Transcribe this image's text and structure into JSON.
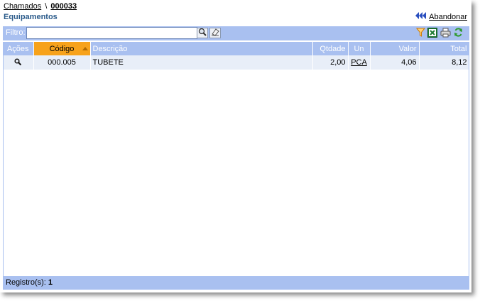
{
  "breadcrumb": {
    "parent": "Chamados",
    "separator": "\\",
    "current": "000033"
  },
  "section_title": "Equipamentos",
  "abandon_label": "Abandonar",
  "filter": {
    "label": "Filtro:",
    "value": ""
  },
  "table": {
    "columns": [
      "Ações",
      "Código",
      "Descrição",
      "Qtdade",
      "Un",
      "Valor",
      "Total"
    ],
    "rows": [
      {
        "codigo": "000.005",
        "descricao": "TUBETE",
        "qtdade": "2,00",
        "un": "PCA",
        "valor": "4,06",
        "total": "8,12"
      }
    ]
  },
  "footer": {
    "label": "Registro(s):",
    "count": "1"
  },
  "colors": {
    "header_bg": "#a9c0f0",
    "sorted_bg": "#f7a21b",
    "row_bg": "#e8eef8",
    "title": "#2a5a8a"
  },
  "icons": [
    "rewind-icon",
    "search-icon",
    "eraser-icon",
    "filter-funnel-icon",
    "excel-icon",
    "print-icon",
    "refresh-icon",
    "magnifier-icon"
  ]
}
